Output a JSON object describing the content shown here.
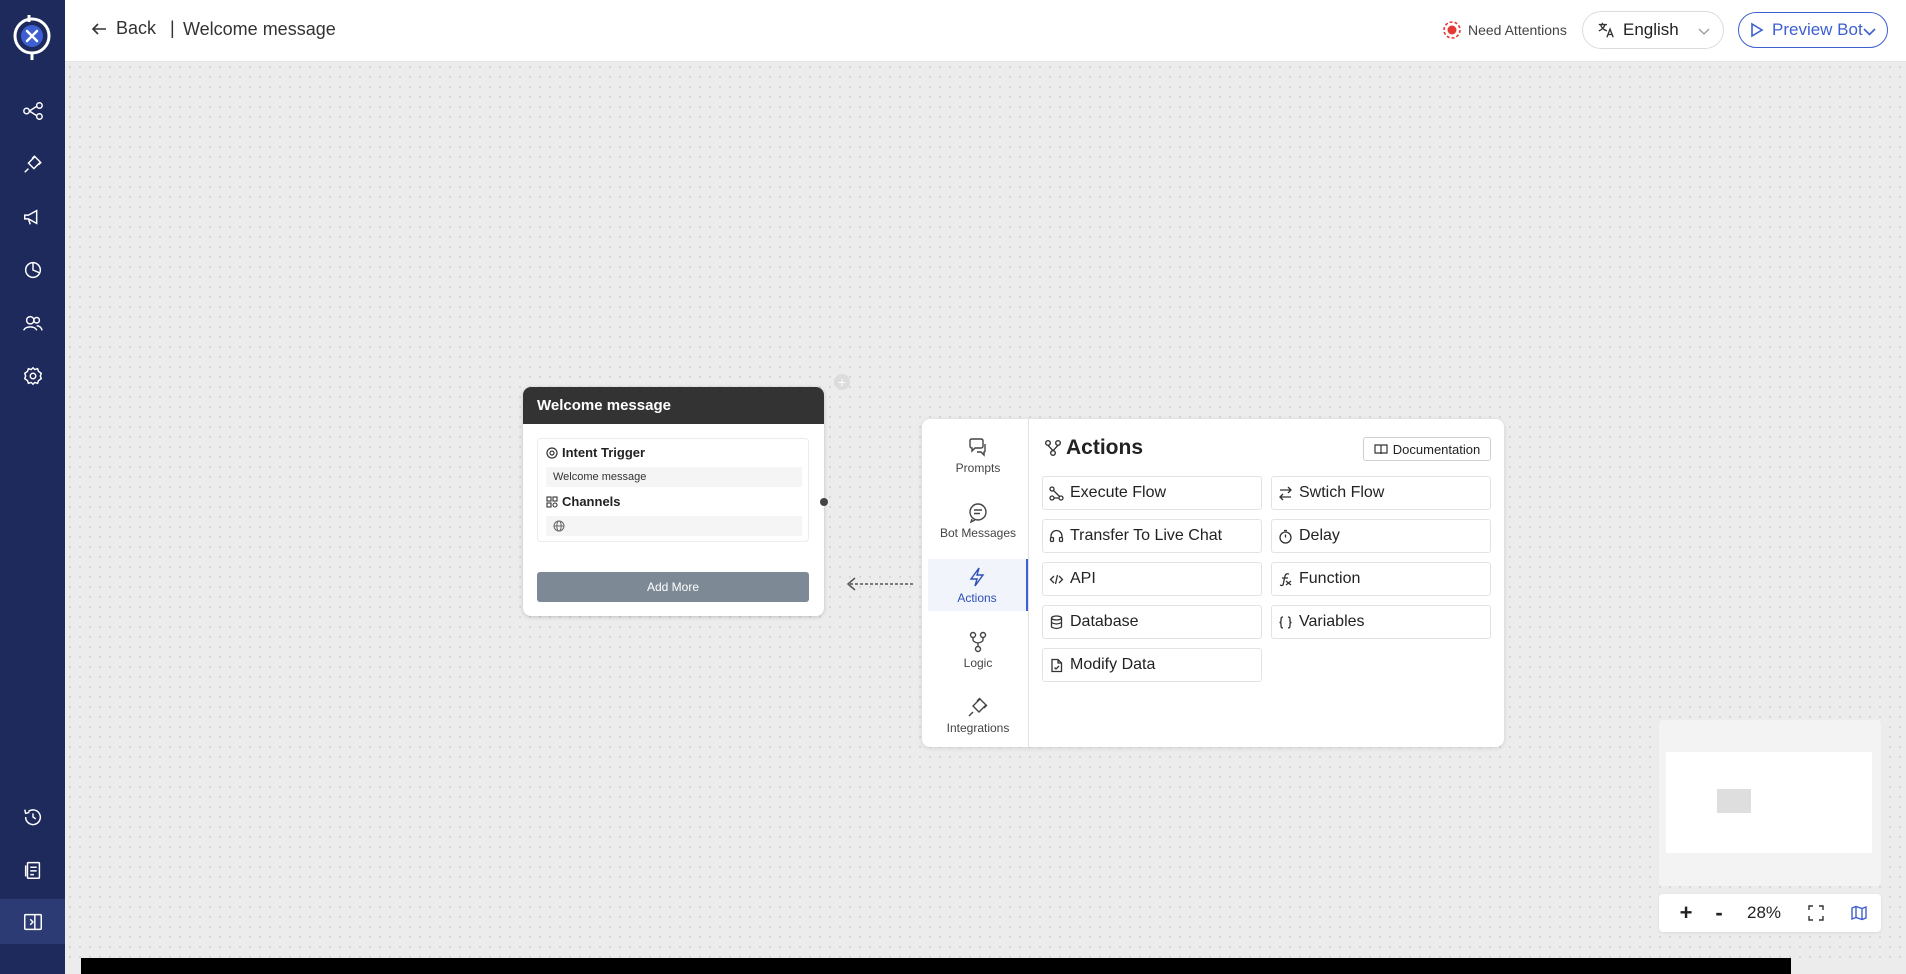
{
  "header": {
    "back_label": "Back",
    "separator": "|",
    "page_title": "Welcome message",
    "attention_label": "Need Attentions",
    "language": "English",
    "preview_label": "Preview Bot"
  },
  "sidebar": {
    "icons": [
      "logo-icon",
      "flows-icon",
      "integrations-icon",
      "broadcast-icon",
      "analytics-icon",
      "users-icon",
      "settings-icon",
      "history-icon",
      "documents-icon",
      "collapse-icon"
    ]
  },
  "node": {
    "title": "Welcome message",
    "trigger_label": "Intent Trigger",
    "trigger_value": "Welcome message",
    "channels_label": "Channels",
    "add_more_label": "Add More",
    "plus": "+"
  },
  "panel": {
    "nav": [
      {
        "label": "Prompts",
        "icon": "prompts-icon"
      },
      {
        "label": "Bot Messages",
        "icon": "bot-messages-icon"
      },
      {
        "label": "Actions",
        "icon": "actions-icon",
        "active": true
      },
      {
        "label": "Logic",
        "icon": "logic-icon"
      },
      {
        "label": "Integrations",
        "icon": "integrations-icon"
      }
    ],
    "title": "Actions",
    "doc_label": "Documentation",
    "actions": [
      {
        "label": "Execute Flow",
        "icon": "execute-flow-icon"
      },
      {
        "label": "Swtich Flow",
        "icon": "switch-flow-icon"
      },
      {
        "label": "Transfer To Live Chat",
        "icon": "headset-icon"
      },
      {
        "label": "Delay",
        "icon": "timer-icon"
      },
      {
        "label": "API",
        "icon": "code-icon"
      },
      {
        "label": "Function",
        "icon": "function-icon"
      },
      {
        "label": "Database",
        "icon": "database-icon"
      },
      {
        "label": "Variables",
        "icon": "braces-icon"
      },
      {
        "label": "Modify Data",
        "icon": "file-icon"
      }
    ]
  },
  "zoom": {
    "plus": "+",
    "minus": "-",
    "level": "28%"
  },
  "colors": {
    "sidebar": "#1d2a5b",
    "accent": "#3d5fd1",
    "node_header": "#333333",
    "add_more": "#7d8a96",
    "attention": "#e53935"
  }
}
